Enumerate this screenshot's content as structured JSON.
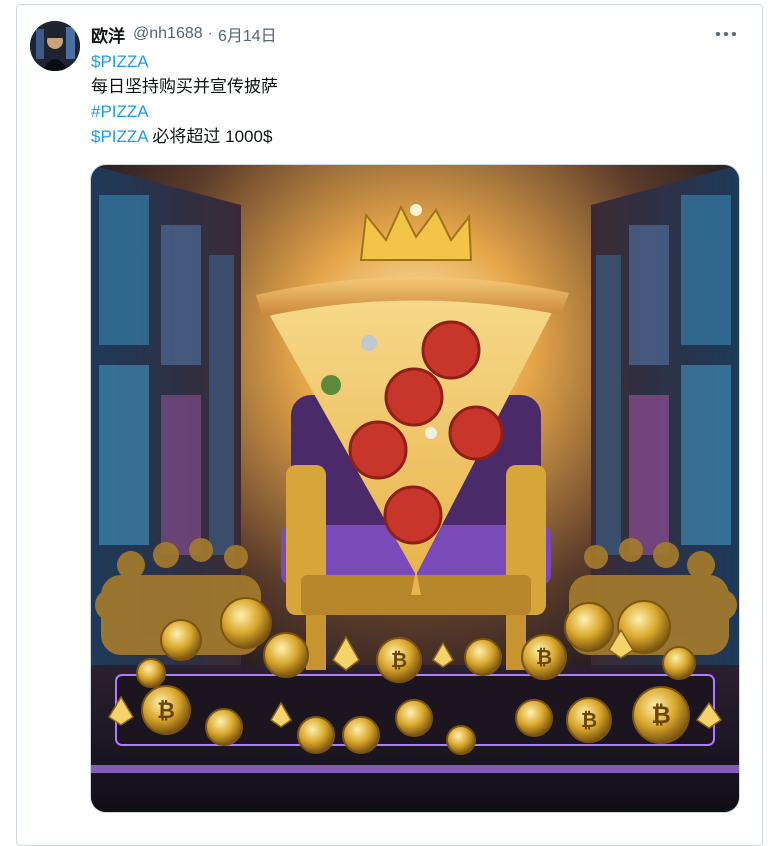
{
  "tweet": {
    "author_name": "欧洋",
    "handle": "@nh1688",
    "separator": "·",
    "date": "6月14日",
    "more_icon": "more-horizontal-icon",
    "lines": [
      {
        "link": "$PIZZA",
        "text": ""
      },
      {
        "link": "",
        "text": "每日坚持购买并宣传披萨"
      },
      {
        "link": "#PIZZA",
        "text": ""
      },
      {
        "link": "$PIZZA",
        "text": " 必将超过 1000$"
      }
    ],
    "colors": {
      "link": "#1d9bf0",
      "secondary": "#536471",
      "border": "#cfd9de"
    }
  }
}
